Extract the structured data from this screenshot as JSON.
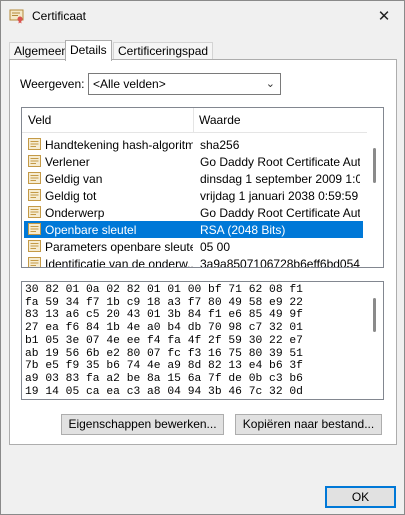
{
  "window": {
    "title": "Certificaat"
  },
  "tabs": [
    {
      "label": "Algemeen",
      "active": false
    },
    {
      "label": "Details",
      "active": true
    },
    {
      "label": "Certificeringspad",
      "active": false
    }
  ],
  "show": {
    "label": "Weergeven:",
    "value": "<Alle velden>"
  },
  "list": {
    "columns": {
      "field": "Veld",
      "value": "Waarde"
    },
    "rows": [
      {
        "field": "Handtekening hash-algoritme",
        "value": "sha256",
        "selected": false
      },
      {
        "field": "Verlener",
        "value": "Go Daddy Root Certificate Aut...",
        "selected": false
      },
      {
        "field": "Geldig van",
        "value": "dinsdag 1 september 2009 1:0...",
        "selected": false
      },
      {
        "field": "Geldig tot",
        "value": "vrijdag 1 januari 2038 0:59:59",
        "selected": false
      },
      {
        "field": "Onderwerp",
        "value": "Go Daddy Root Certificate Aut...",
        "selected": false
      },
      {
        "field": "Openbare sleutel",
        "value": "RSA (2048 Bits)",
        "selected": true
      },
      {
        "field": "Parameters openbare sleutel",
        "value": "05 00",
        "selected": false
      },
      {
        "field": "Identificatie van de onderw...",
        "value": "3a9a8507106728b6eff6bd054...",
        "selected": false
      }
    ]
  },
  "hex": {
    "lines": [
      "30 82 01 0a 02 82 01 01 00 bf 71 62 08 f1",
      "fa 59 34 f7 1b c9 18 a3 f7 80 49 58 e9 22",
      "83 13 a6 c5 20 43 01 3b 84 f1 e6 85 49 9f",
      "27 ea f6 84 1b 4e a0 b4 db 70 98 c7 32 01",
      "b1 05 3e 07 4e ee f4 fa 4f 2f 59 30 22 e7",
      "ab 19 56 6b e2 80 07 fc f3 16 75 80 39 51",
      "7b e5 f9 35 b6 74 4e a9 8d 82 13 e4 b6 3f",
      "a9 03 83 fa a2 be 8a 15 6a 7f de 0b c3 b6",
      "19 14 05 ca ea c3 a8 04 94 3b 46 7c 32 0d"
    ]
  },
  "buttons": {
    "edit": "Eigenschappen bewerken...",
    "copy": "Kopiëren naar bestand...",
    "ok": "OK"
  },
  "colors": {
    "accent": "#0078d7",
    "cert_icon": "#c49a47"
  }
}
